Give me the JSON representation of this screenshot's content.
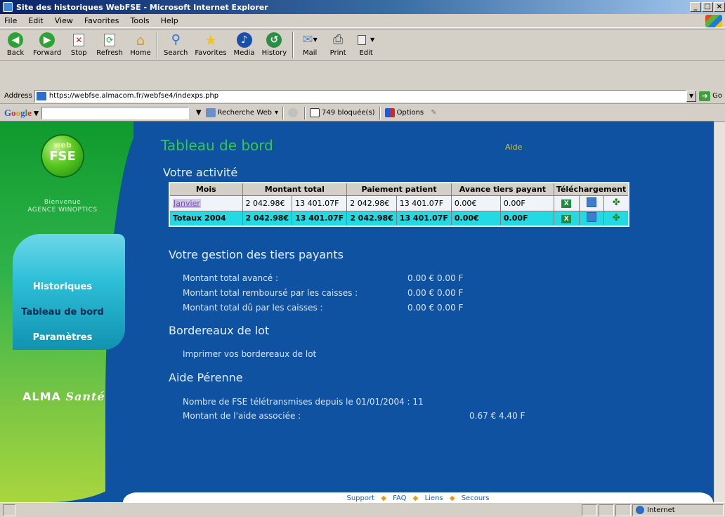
{
  "window": {
    "title": "Site des historiques WebFSE - Microsoft Internet Explorer"
  },
  "menu": [
    "File",
    "Edit",
    "View",
    "Favorites",
    "Tools",
    "Help"
  ],
  "toolbar": {
    "back": "Back",
    "forward": "Forward",
    "stop": "Stop",
    "refresh": "Refresh",
    "home": "Home",
    "search": "Search",
    "favorites": "Favorites",
    "media": "Media",
    "history": "History",
    "mail": "Mail",
    "print": "Print",
    "edit": "Edit"
  },
  "address": {
    "label": "Address",
    "url": "https://webfse.almacom.fr/webfse4/indexps.php",
    "go": "Go"
  },
  "googlebar": {
    "logo": "Google",
    "search_web": "Recherche Web",
    "blocked": "749 bloquée(s)",
    "options": "Options"
  },
  "sidebar": {
    "welcome": "Bienvenue",
    "agency": "AGENCE WINOPTICS",
    "nav": [
      "Historiques",
      "Tableau de bord",
      "Paramètres"
    ],
    "brand_a": "ALMA",
    "brand_b": "Santé"
  },
  "page": {
    "title": "Tableau de bord",
    "help": "Aide",
    "activity_heading": "Votre activité",
    "table_headers": [
      "Mois",
      "Montant total",
      "Paiement patient",
      "Avance tiers payant",
      "Téléchargement"
    ],
    "rows": [
      {
        "month": "Janvier",
        "total_eur": "2 042.98€",
        "total_frf": "13 401.07F",
        "patient_eur": "2 042.98€",
        "patient_frf": "13 401.07F",
        "advance_eur": "0.00€",
        "advance_frf": "0.00F"
      }
    ],
    "totals": {
      "label": "Totaux 2004",
      "total_eur": "2 042.98€",
      "total_frf": "13 401.07F",
      "patient_eur": "2 042.98€",
      "patient_frf": "13 401.07F",
      "advance_eur": "0.00€",
      "advance_frf": "0.00F"
    },
    "tiers_heading": "Votre gestion des tiers payants",
    "tiers_lines": [
      {
        "label": "Montant total avancé :",
        "value": "0.00 €  0.00 F"
      },
      {
        "label": "Montant total remboursé par les caisses :",
        "value": "0.00 €  0.00 F"
      },
      {
        "label": "Montant total dû par les caisses :",
        "value": "0.00 €  0.00 F"
      }
    ],
    "bordereaux_heading": "Bordereaux de lot",
    "bordereaux_link": "Imprimer vos bordereaux de lot",
    "aide_heading": "Aide Pérenne",
    "aide_lines": [
      {
        "label": "Nombre de FSE télétransmises depuis le 01/01/2004 : 11",
        "value": ""
      },
      {
        "label": "Montant de l'aide associée :",
        "value": "0.67 €  4.40 F"
      }
    ]
  },
  "footer": [
    "Support",
    "FAQ",
    "Liens",
    "Secours"
  ],
  "status": {
    "zone": "Internet"
  }
}
